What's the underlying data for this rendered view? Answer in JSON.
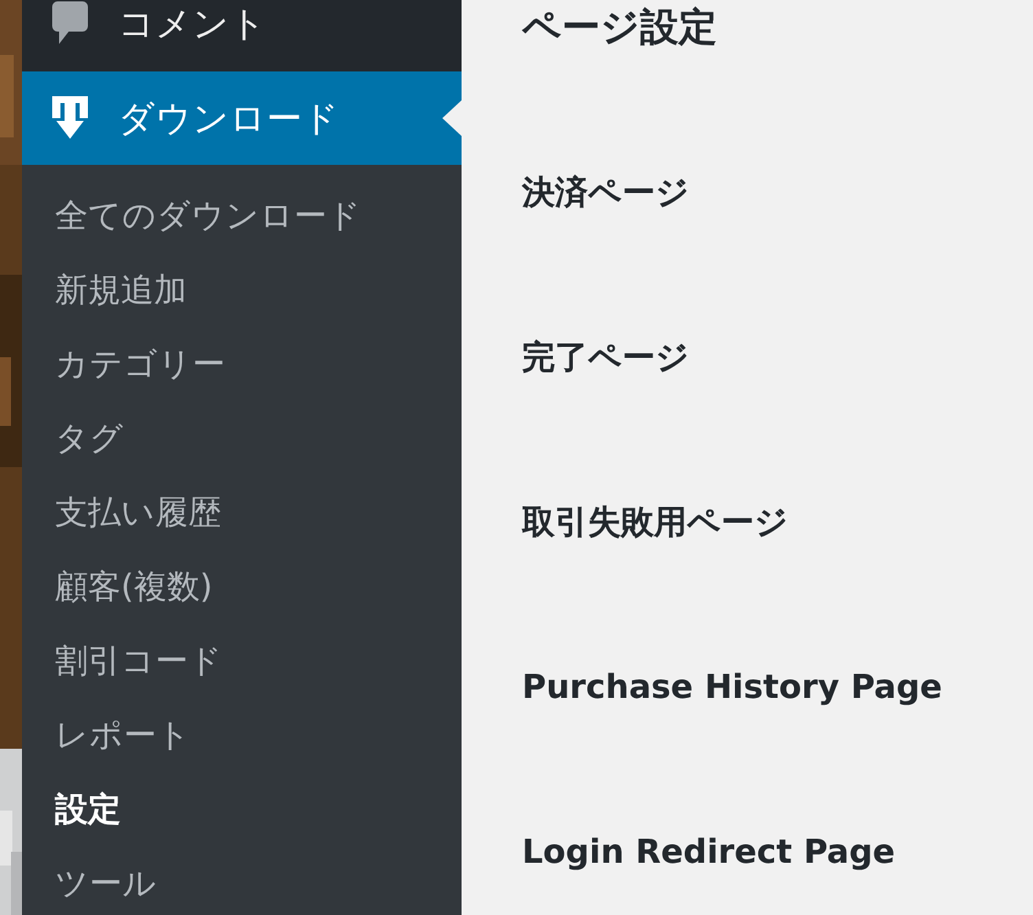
{
  "menu": [
    {
      "label": "コメント",
      "kind": "comment",
      "selected": false
    },
    {
      "label": "ダウンロード",
      "kind": "download",
      "selected": true
    }
  ],
  "submenu": [
    {
      "label": "全てのダウンロード",
      "selected": false
    },
    {
      "label": "新規追加",
      "selected": false
    },
    {
      "label": "カテゴリー",
      "selected": false
    },
    {
      "label": "タグ",
      "selected": false
    },
    {
      "label": "支払い履歴",
      "selected": false
    },
    {
      "label": "顧客(複数)",
      "selected": false
    },
    {
      "label": "割引コード",
      "selected": false
    },
    {
      "label": "レポート",
      "selected": false
    },
    {
      "label": "設定",
      "selected": true
    },
    {
      "label": "ツール",
      "selected": false
    }
  ],
  "page": {
    "title": "ページ設定",
    "fields": [
      "決済ページ",
      "完了ページ",
      "取引失敗用ページ",
      "Purchase History Page",
      "Login Redirect Page"
    ]
  }
}
